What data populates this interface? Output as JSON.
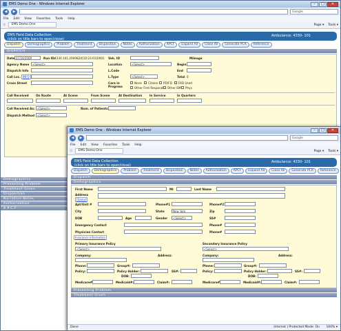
{
  "browser": {
    "title": "EMS Demo One - Windows Internet Explorer",
    "address": "",
    "search_placeholder": "Google",
    "menu": [
      "File",
      "Edit",
      "View",
      "Favorites",
      "Tools",
      "Help"
    ],
    "tab_label": "EMS Demo One",
    "toolbar": [
      "Page ▾",
      "Tools ▾"
    ],
    "status": "Done",
    "zone": "Internet | Protected Mode: On",
    "zoom": "100% ▾"
  },
  "app": {
    "header_line1": "EMS Field Data Collection",
    "header_line2": "(click on title bars to open/close)",
    "ambulance": "Ambulance: 4330- 101",
    "buttons": [
      "Dispatch",
      "Demographics",
      "Problem",
      "Treatment",
      "Disposition",
      "Notes",
      "Authorization",
      "APCF",
      "Expand All",
      "Close All",
      "Generate PCR",
      "Reference"
    ]
  },
  "back_window": {
    "dispatch_title": "Dispatch",
    "date_label": "Date",
    "date_value": "07/24/2009",
    "run_label": "Run ID:",
    "run_value": "4330.101.2009824[10:23:01]0001",
    "veh_label": "Veh. ID",
    "mileage_label": "Mileage",
    "agency_label": "Agency Name",
    "agency_value": "<Select>",
    "location_label": "Location",
    "location_value": "<Select>",
    "begin_label": "Begin",
    "dispinfo_label": "Dispatch Info",
    "lcode_label": "L.Code",
    "end_label": "End",
    "callloc_label": "Call Loc.",
    "info_link": "INFO",
    "ltype_label": "L.Type",
    "ltype_value": "<Select>",
    "total_label": "Total",
    "total_value": "0",
    "cross_label": "Cross Street",
    "care_label": "Care in Progress",
    "care_opts": [
      "None",
      "Citizen",
      "PD/FD",
      "FAD Used",
      "Other First Responder",
      "Other EMS",
      "Phys"
    ],
    "times": [
      "Call Received",
      "On Route",
      "At Scene",
      "From Scene",
      "At Destination",
      "In Service",
      "In Quarters"
    ],
    "callrecv_as_label": "Call Received As:",
    "callrecv_as_value": "<Select>",
    "numpat_label": "Num. of Patients:",
    "dispmethod_label": "Dispatch Method",
    "dispmethod_value": "<Select>",
    "sections": [
      "Demographics",
      "Presenting Problem",
      "Treatment Given",
      "Disposition",
      "Narrative Notes",
      "Authorization",
      "A.P.C.F."
    ]
  },
  "front_window": {
    "dispatch_title": "Dispatch",
    "demographics_title": "Demographics",
    "first": "First Name",
    "mi": "MI",
    "last": "Last Name",
    "address": "Address",
    "same": "[Same]",
    "apt": "Apt/Unit #",
    "phone1": "Phone#1",
    "phone2": "Phone#2",
    "city": "City",
    "state": "State",
    "state_value": "New York",
    "zip": "Zip",
    "dob": "DOB",
    "age": "Age",
    "gender": "Gender",
    "gender_value": "<Select>",
    "ssn": "SS#",
    "emergency": "Emergency Contact",
    "physician": "Physician Contact",
    "phone": "Phone#",
    "insurance_link": "Insurance Information",
    "primary": "Primary Insurance Policy",
    "secondary": "Secondary Insurance Policy",
    "select": "<Select>",
    "company": "Company:",
    "address2": "Address:",
    "phone_lbl": "Phone:",
    "group": "Group#:",
    "policy": "Policy:",
    "policy_holder": "Policy Holder:",
    "ssn2": "SS#:",
    "dob2": "DOB:",
    "medicare": "Medicare#:",
    "medicaid": "Medicaid#:",
    "claim": "Claim#:",
    "sections": [
      "Presenting Problem",
      "Treatment Given"
    ]
  }
}
